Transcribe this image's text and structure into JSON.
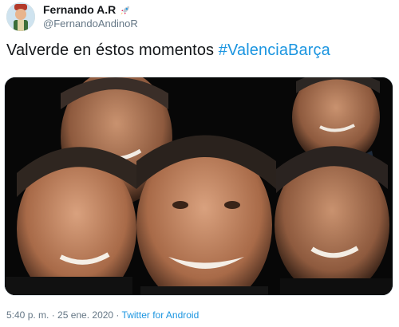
{
  "author": {
    "display_name": "Fernando A.R",
    "handle": "@FernandoAndinoR",
    "badge_icon": "rocket-icon"
  },
  "tweet": {
    "text": "Valverde en éstos momentos ",
    "hashtag": "#ValenciaBarça"
  },
  "media": {
    "icon": "photo-collage-image"
  },
  "footer": {
    "timestamp": "5:40 p. m. · 25 ene. 2020 · ",
    "source": "Twitter for Android"
  },
  "colors": {
    "link": "#1b95e0",
    "secondary_text": "#657786",
    "primary_text": "#14171a"
  }
}
